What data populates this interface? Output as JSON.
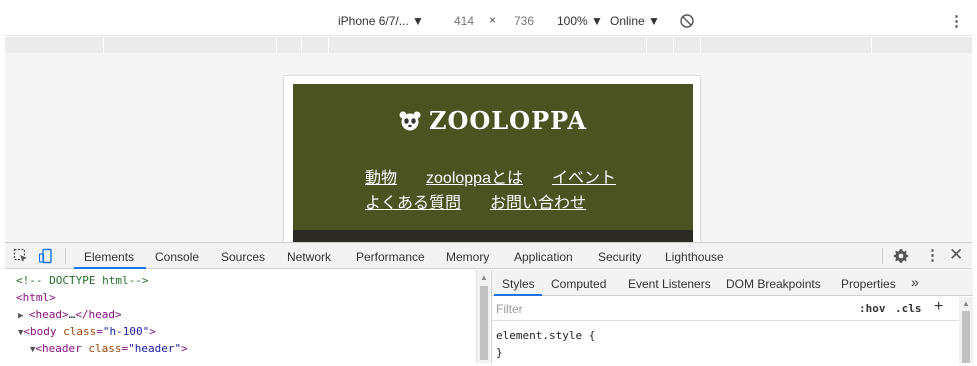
{
  "device_toolbar": {
    "device": "iPhone 6/7/... ▼",
    "width": "414",
    "times": "×",
    "height": "736",
    "zoom": "100% ▼",
    "network": "Online ▼"
  },
  "site": {
    "logo_text": "ZOOLOPPA",
    "nav_row1": [
      "動物",
      "zooloppaとは",
      "イベント"
    ],
    "nav_row2": [
      "よくある質問",
      "お問い合わせ"
    ],
    "colors": {
      "header_bg": "#4b5323",
      "text": "#ffffff"
    }
  },
  "devtools": {
    "tabs": [
      "Elements",
      "Console",
      "Sources",
      "Network",
      "Performance",
      "Memory",
      "Application",
      "Security",
      "Lighthouse"
    ],
    "active_tab": "Elements",
    "more_tabs": "»",
    "elements": {
      "line1": "<!-- DOCTYPE html-->",
      "line2_tag": "<html>",
      "line3_open": "<head>",
      "line3_ellipsis": "…",
      "line3_close": "</head>",
      "line4_tag": "<body",
      "line4_attr": "class",
      "line4_val": "\"h-100\"",
      "line4_end": ">",
      "line5_tag": "<header",
      "line5_attr": "class",
      "line5_val": "\"header\"",
      "line5_end": ">"
    },
    "styles": {
      "tabs": [
        "Styles",
        "Computed",
        "Event Listeners",
        "DOM Breakpoints",
        "Properties"
      ],
      "active_tab": "Styles",
      "filter_placeholder": "Filter",
      "hov": ":hov",
      "cls": ".cls",
      "plus": "+",
      "rule_selector": "element.style {",
      "rule_close": "}"
    },
    "accent": "#1a73e8"
  }
}
